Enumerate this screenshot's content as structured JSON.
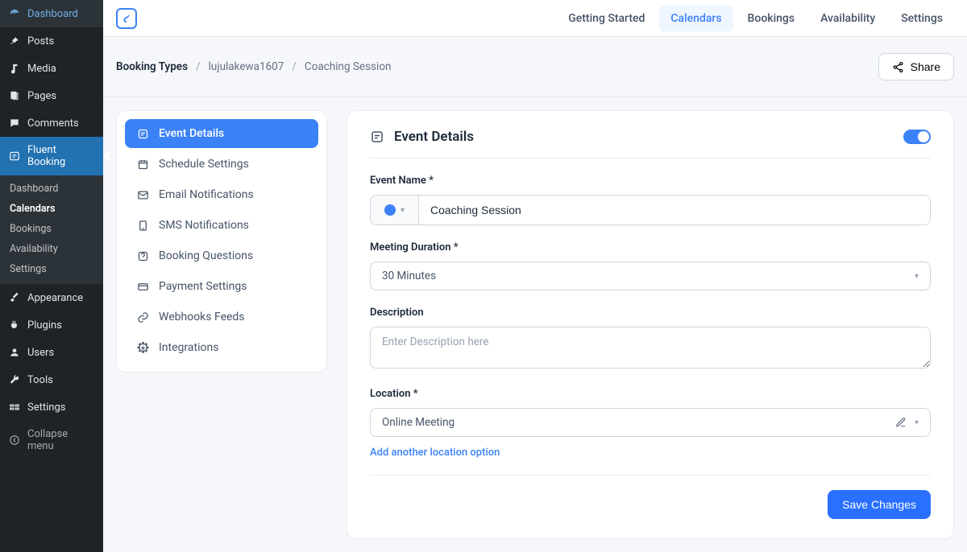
{
  "wp_sidebar": {
    "items_top": [
      {
        "icon": "dashboard-icon",
        "label": "Dashboard"
      },
      {
        "icon": "pin-icon",
        "label": "Posts"
      },
      {
        "icon": "media-icon",
        "label": "Media"
      },
      {
        "icon": "page-icon",
        "label": "Pages"
      },
      {
        "icon": "comment-icon",
        "label": "Comments"
      }
    ],
    "active": {
      "icon": "fluent-icon",
      "label": "Fluent Booking"
    },
    "sub_items": [
      {
        "label": "Dashboard",
        "current": false
      },
      {
        "label": "Calendars",
        "current": true
      },
      {
        "label": "Bookings",
        "current": false
      },
      {
        "label": "Availability",
        "current": false
      },
      {
        "label": "Settings",
        "current": false
      }
    ],
    "items_bottom": [
      {
        "icon": "brush-icon",
        "label": "Appearance"
      },
      {
        "icon": "plugin-icon",
        "label": "Plugins"
      },
      {
        "icon": "user-icon",
        "label": "Users"
      },
      {
        "icon": "wrench-icon",
        "label": "Tools"
      },
      {
        "icon": "settings-icon",
        "label": "Settings"
      }
    ],
    "collapse": {
      "icon": "collapse-icon",
      "label": "Collapse menu"
    }
  },
  "topnav": [
    {
      "label": "Getting Started",
      "active": false
    },
    {
      "label": "Calendars",
      "active": true
    },
    {
      "label": "Bookings",
      "active": false
    },
    {
      "label": "Availability",
      "active": false
    },
    {
      "label": "Settings",
      "active": false
    }
  ],
  "breadcrumb": {
    "root": "Booking Types",
    "user": "lujulakewa1607",
    "current": "Coaching Session"
  },
  "share_label": "Share",
  "settings_nav": [
    {
      "icon": "details-icon",
      "label": "Event Details",
      "active": true
    },
    {
      "icon": "clock-icon",
      "label": "Schedule Settings",
      "active": false
    },
    {
      "icon": "mail-icon",
      "label": "Email Notifications",
      "active": false
    },
    {
      "icon": "sms-icon",
      "label": "SMS Notifications",
      "active": false
    },
    {
      "icon": "question-icon",
      "label": "Booking Questions",
      "active": false
    },
    {
      "icon": "payment-icon",
      "label": "Payment Settings",
      "active": false
    },
    {
      "icon": "link-icon",
      "label": "Webhooks Feeds",
      "active": false
    },
    {
      "icon": "integration-icon",
      "label": "Integrations",
      "active": false
    }
  ],
  "form": {
    "title": "Event Details",
    "labels": {
      "event_name": "Event Name *",
      "duration": "Meeting Duration *",
      "description": "Description",
      "location": "Location *"
    },
    "values": {
      "event_name": "Coaching Session",
      "duration": "30 Minutes",
      "location": "Online Meeting"
    },
    "placeholders": {
      "description": "Enter Description here"
    },
    "add_location": "Add another location option",
    "save": "Save Changes",
    "color": "#3b82f6"
  }
}
